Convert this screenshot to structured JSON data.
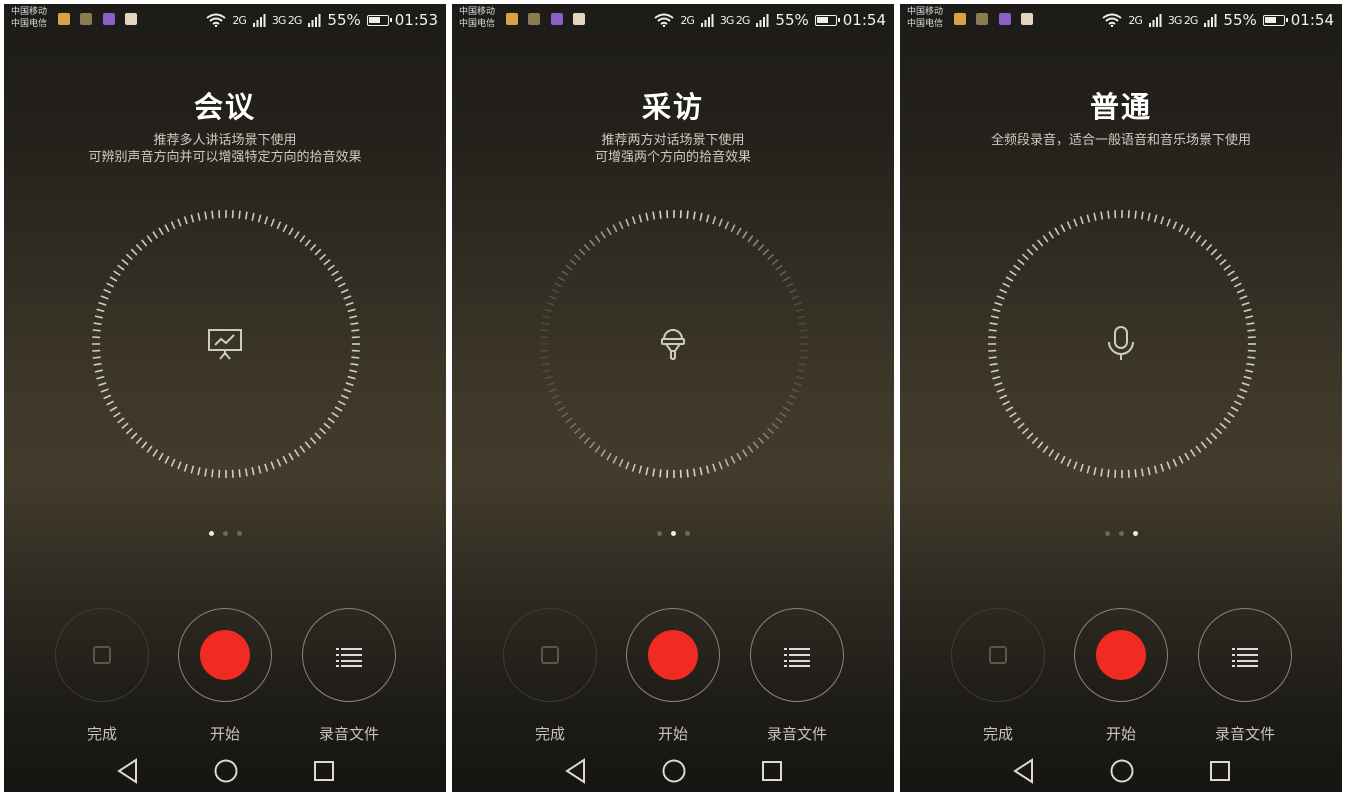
{
  "screens": [
    {
      "status": {
        "carrier1": "中国移动",
        "carrier2": "中国电信",
        "net1": "2G",
        "net2": "3G 2G",
        "battery": "55%",
        "time": "01:53"
      },
      "mode": {
        "title": "会议",
        "desc1": "推荐多人讲话场景下使用",
        "desc2": "可辨别声音方向并可以增强特定方向的拾音效果",
        "icon": "presentation-board-icon"
      },
      "page_index": 0,
      "controls": {
        "done": "完成",
        "start": "开始",
        "files": "录音文件"
      }
    },
    {
      "status": {
        "carrier1": "中国移动",
        "carrier2": "中国电信",
        "net1": "2G",
        "net2": "3G 2G",
        "battery": "55%",
        "time": "01:54"
      },
      "mode": {
        "title": "采访",
        "desc1": "推荐两方对话场景下使用",
        "desc2": "可增强两个方向的拾音效果",
        "icon": "interview-microphone-icon"
      },
      "page_index": 1,
      "controls": {
        "done": "完成",
        "start": "开始",
        "files": "录音文件"
      }
    },
    {
      "status": {
        "carrier1": "中国移动",
        "carrier2": "中国电信",
        "net1": "2G",
        "net2": "3G 2G",
        "battery": "55%",
        "time": "01:54"
      },
      "mode": {
        "title": "普通",
        "desc1": "全频段录音，适合一般语音和音乐场景下使用",
        "desc2": "",
        "icon": "microphone-icon"
      },
      "page_index": 2,
      "controls": {
        "done": "完成",
        "start": "开始",
        "files": "录音文件"
      }
    }
  ],
  "colors": {
    "record_red": "#f02b22",
    "title_white": "#ffffff",
    "bg_gold": "#433c2d"
  }
}
